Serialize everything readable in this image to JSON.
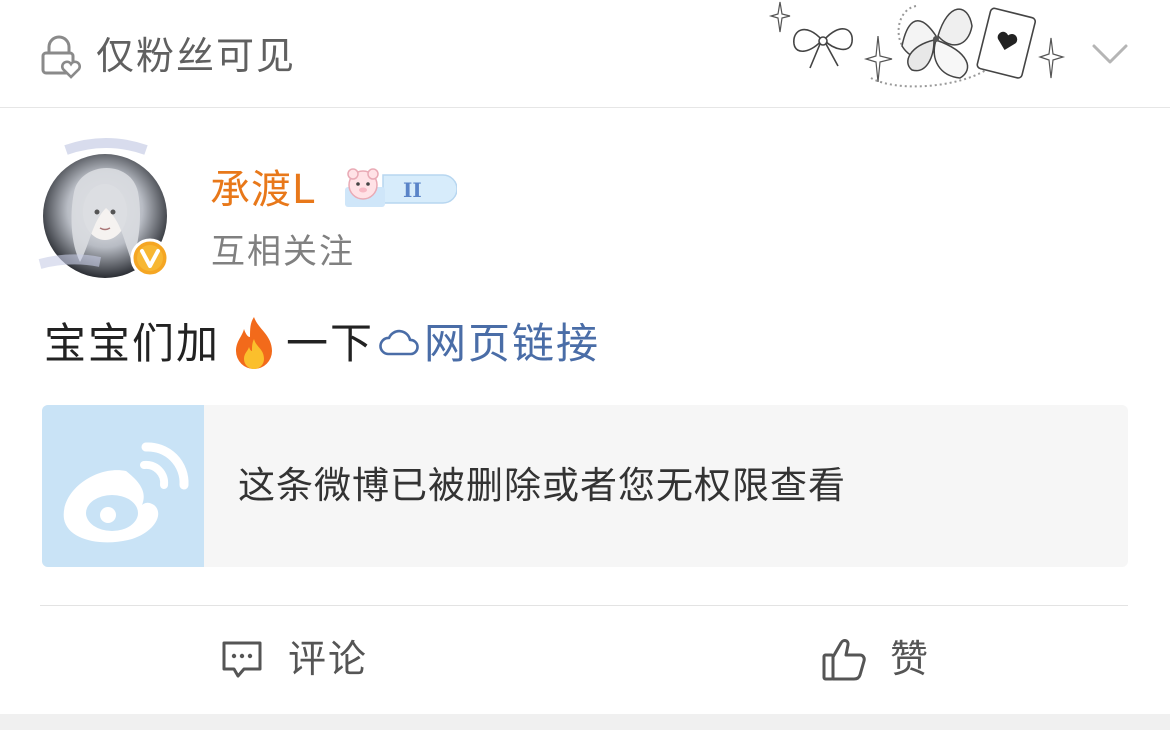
{
  "header": {
    "visibility_label": "仅粉丝可见",
    "visibility_icon": "lock-heart-icon",
    "collapse_icon": "chevron-down-icon"
  },
  "author": {
    "name": "承渡L",
    "relation": "互相关注",
    "verified": true,
    "name_color": "#e8781a"
  },
  "post": {
    "text_before": "宝宝们加",
    "emoji": "fire-icon",
    "text_after": "一下",
    "link_icon": "link-icon",
    "link_text": "网页链接",
    "link_color": "#4a6da7"
  },
  "deleted_card": {
    "message": "这条微博已被删除或者您无权限查看",
    "thumb_icon": "weibo-logo-icon"
  },
  "actions": {
    "comment_label": "评论",
    "like_label": "赞"
  }
}
